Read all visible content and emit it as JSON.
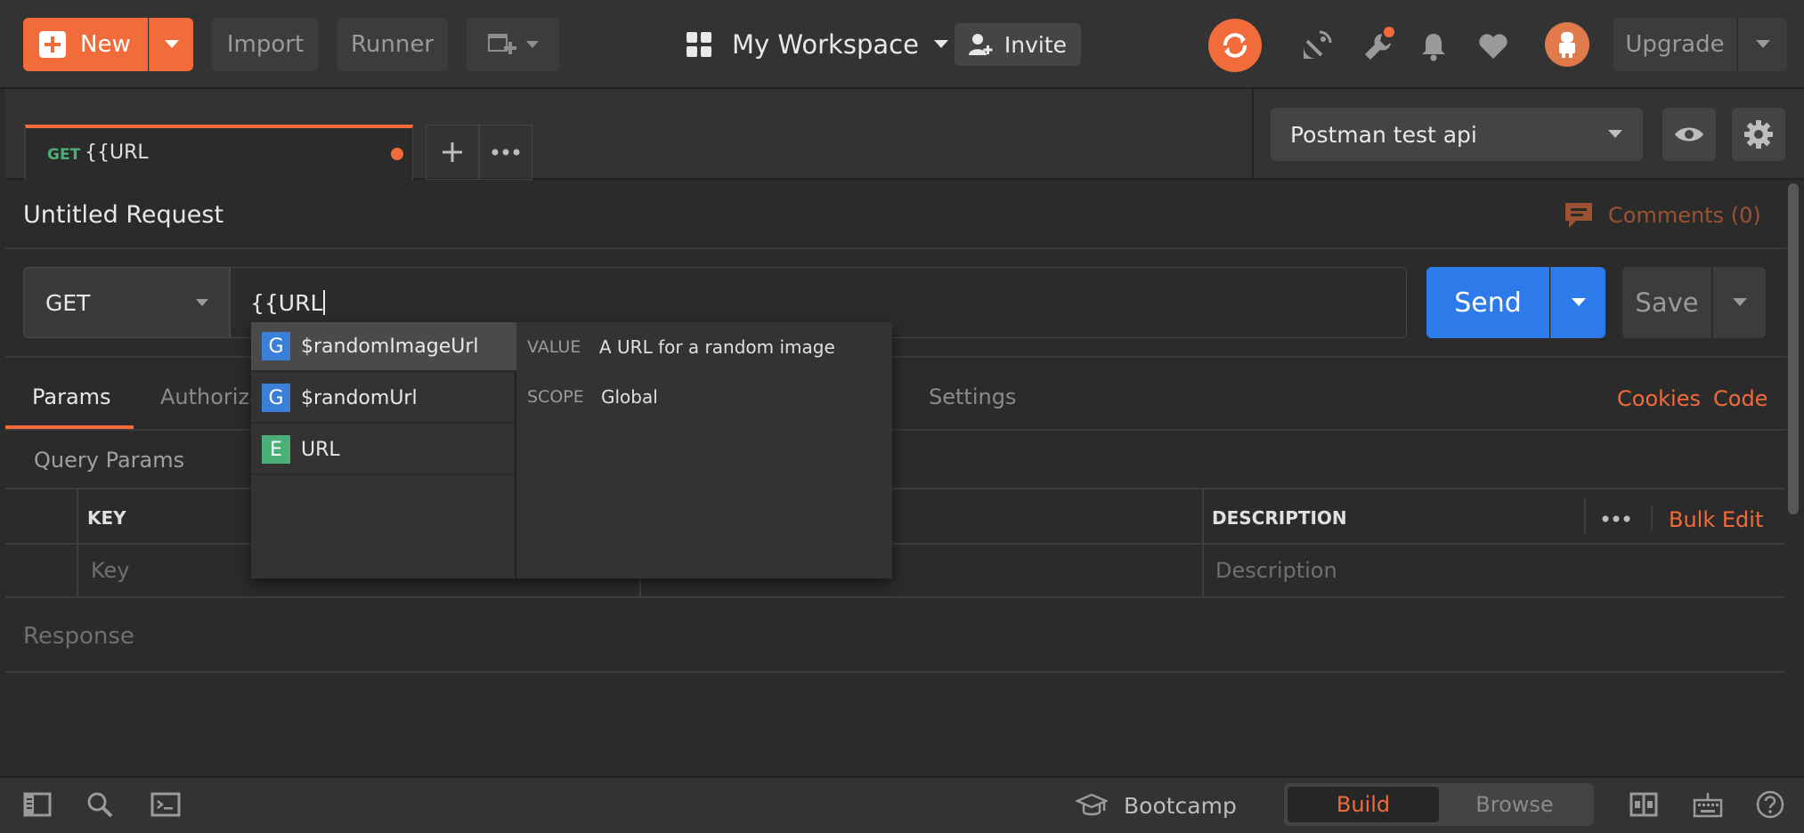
{
  "header": {
    "new_label": "New",
    "import_label": "Import",
    "runner_label": "Runner",
    "workspace_label": "My Workspace",
    "invite_label": "Invite",
    "upgrade_label": "Upgrade"
  },
  "environment": {
    "selected": "Postman test api"
  },
  "request_tab": {
    "method": "GET",
    "title": "{{URL"
  },
  "request": {
    "name": "Untitled Request",
    "comments_label": "Comments (0)",
    "method": "GET",
    "url_value": "{{URL",
    "send_label": "Send",
    "save_label": "Save"
  },
  "autocomplete": {
    "items": [
      {
        "badge": "G",
        "label": "$randomImageUrl"
      },
      {
        "badge": "G",
        "label": "$randomUrl"
      },
      {
        "badge": "E",
        "label": "URL"
      }
    ],
    "detail": {
      "value_key": "VALUE",
      "value_text": "A URL for a random image",
      "scope_key": "SCOPE",
      "scope_text": "Global"
    }
  },
  "tabs": {
    "params": "Params",
    "authorization": "Authoriza",
    "settings": "Settings",
    "cookies": "Cookies",
    "code": "Code"
  },
  "params": {
    "section_title": "Query Params",
    "col_key": "KEY",
    "col_description": "DESCRIPTION",
    "bulk_edit": "Bulk Edit",
    "key_placeholder": "Key",
    "description_placeholder": "Description"
  },
  "response": {
    "title": "Response"
  },
  "footer": {
    "bootcamp_label": "Bootcamp",
    "build_label": "Build",
    "browse_label": "Browse"
  },
  "colors": {
    "accent": "#f26b3a",
    "send_blue": "#2d7bea",
    "global_badge": "#3b80d8",
    "env_badge": "#4caf78"
  }
}
